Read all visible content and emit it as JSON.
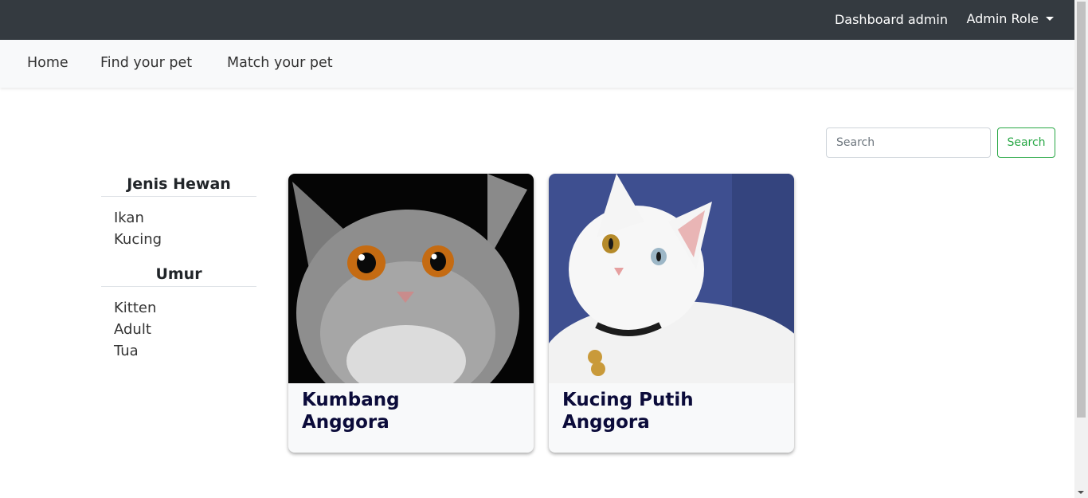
{
  "topbar": {
    "dashboard": "Dashboard admin",
    "role": "Admin Role"
  },
  "nav": {
    "home": "Home",
    "find": "Find your pet",
    "match": "Match your pet"
  },
  "search": {
    "placeholder": "Search",
    "button": "Search"
  },
  "sidebar": {
    "jenis_title": "Jenis Hewan",
    "jenis": [
      "Ikan",
      "Kucing"
    ],
    "umur_title": "Umur",
    "umur": [
      "Kitten",
      "Adult",
      "Tua"
    ]
  },
  "cards": [
    {
      "title": "Kumbang\nAnggora"
    },
    {
      "title": "Kucing  Putih\nAnggora"
    }
  ],
  "colors": {
    "topbar": "#343a40",
    "navbar": "#f8f9fa",
    "search_accent": "#28a745",
    "card_title": "#0b0b3a"
  }
}
